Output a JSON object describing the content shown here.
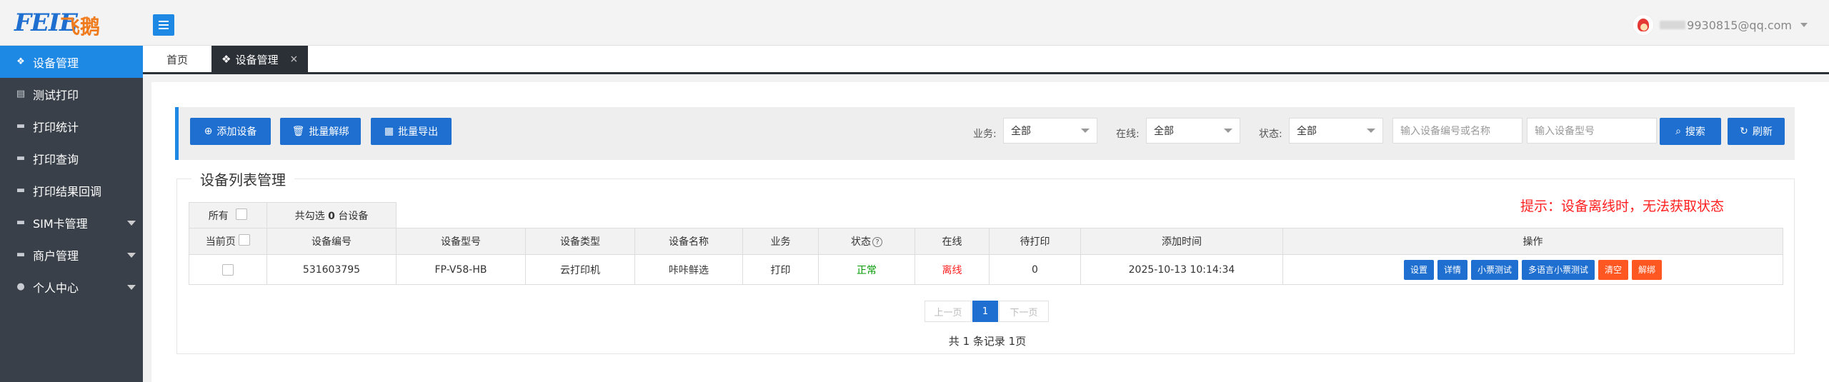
{
  "brand": {
    "logo_latin": "FEIE",
    "logo_cn": "飞鹅"
  },
  "user": {
    "email_visible": "9930815@qq.com"
  },
  "sidebar": {
    "items": [
      {
        "label": "设备管理",
        "icon": "devices-icon",
        "active": true
      },
      {
        "label": "测试打印",
        "icon": "document-icon"
      },
      {
        "label": "打印统计",
        "icon": "chat-icon"
      },
      {
        "label": "打印查询",
        "icon": "chat-icon"
      },
      {
        "label": "打印结果回调",
        "icon": "chat-icon"
      },
      {
        "label": "SIM卡管理",
        "icon": "chat-icon",
        "expandable": true
      },
      {
        "label": "商户管理",
        "icon": "chat-icon",
        "expandable": true
      },
      {
        "label": "个人中心",
        "icon": "user-icon",
        "expandable": true
      }
    ]
  },
  "tabs": {
    "home": "首页",
    "device": "设备管理",
    "close": "×"
  },
  "toolbar": {
    "add_label": "添加设备",
    "unbind_label": "批量解绑",
    "export_label": "批量导出",
    "business_label": "业务:",
    "business_value": "全部",
    "online_label": "在线:",
    "online_value": "全部",
    "status_label": "状态:",
    "status_value": "全部",
    "search_code_placeholder": "输入设备编号或名称",
    "search_model_placeholder": "输入设备型号",
    "search_label": "搜索",
    "refresh_label": "刷新"
  },
  "section": {
    "title": "设备列表管理",
    "hint": "提示：设备离线时，无法获取状态",
    "all_label": "所有",
    "selected_prefix": "共勾选",
    "selected_count": "0",
    "selected_suffix": "台设备",
    "current_page_label": "当前页"
  },
  "table": {
    "columns": [
      "设备编号",
      "设备型号",
      "设备类型",
      "设备名称",
      "业务",
      "状态",
      "在线",
      "待打印",
      "添加时间",
      "操作"
    ],
    "rows": [
      {
        "code": "531603795",
        "model": "FP-V58-HB",
        "type": "云打印机",
        "name": "咔咔鲜选",
        "business": "打印",
        "status": "正常",
        "online": "离线",
        "pending": "0",
        "added": "2025-10-13 10:14:34"
      }
    ],
    "ops": {
      "settings": "设置",
      "detail": "详情",
      "ticket_test": "小票测试",
      "multi_lang_test": "多语言小票测试",
      "clear": "清空",
      "unbind": "解绑"
    }
  },
  "pagination": {
    "prev": "上一页",
    "current": "1",
    "next": "下一页",
    "summary": "共 1 条记录 1页"
  },
  "colors": {
    "accent": "#1e6fd0",
    "sidebar": "#394049",
    "danger": "#ff5722",
    "offline": "#ff2222",
    "ok": "#009900"
  }
}
